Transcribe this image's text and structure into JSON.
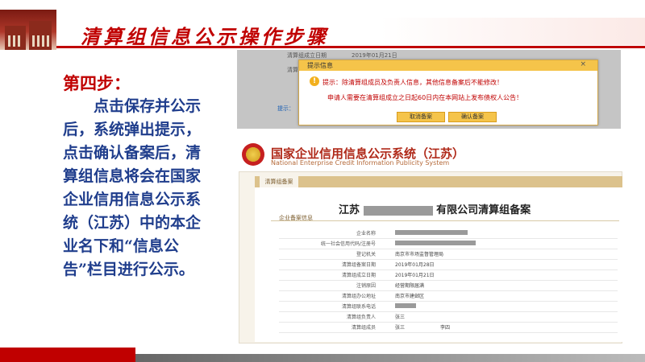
{
  "header": {
    "title": "清算组信息公示操作步骤"
  },
  "step": {
    "title": "第四步：",
    "body": "点击保存并公示后，系统弹出提示，点击确认备案后，清算组信息将会在国家企业信用信息公示系统（江苏）中的本企业名下和“信息公告”栏目进行公示。"
  },
  "top_shot": {
    "bg_label1": "清算组成立日期",
    "bg_date": "2019年01月21日",
    "bg_label2": "清算组成员",
    "bg_label3": "提示："
  },
  "dialog": {
    "title": "提示信息",
    "close": "×",
    "warn_glyph": "!",
    "line1": "提示：除清算组成员及负责人信息，其他信息备案后不能修改！",
    "line2": "申请人需要在清算组成立之日起60日内在本网站上发布债权人公告！",
    "cancel": "取消备案",
    "confirm": "确认备案"
  },
  "system": {
    "title": "国家企业信用信息公示系统（江苏）",
    "subtitle": "National Enterprise Credit Information Publicity System",
    "tab": "清算组备案",
    "panel_title_prefix": "江苏",
    "panel_title_suffix": "有限公司清算组备案",
    "section": "企业备案信息"
  },
  "rows": [
    {
      "label": "企业名称",
      "value": ""
    },
    {
      "label": "统一社会信用代码/注册号",
      "value": ""
    },
    {
      "label": "登记机关",
      "value": "南京市市场监督管理局"
    },
    {
      "label": "清算组备案日期",
      "value": "2019年01月28日"
    },
    {
      "label": "清算组成立日期",
      "value": "2019年01月21日"
    },
    {
      "label": "注销原因",
      "value": "经营期限届满"
    },
    {
      "label": "清算组办公地址",
      "value": "南京市建邺区"
    },
    {
      "label": "清算组联系电话",
      "value": ""
    },
    {
      "label": "清算组负责人",
      "value": "张三"
    },
    {
      "label": "清算组成员",
      "value": "张三",
      "value2": "李四"
    }
  ]
}
